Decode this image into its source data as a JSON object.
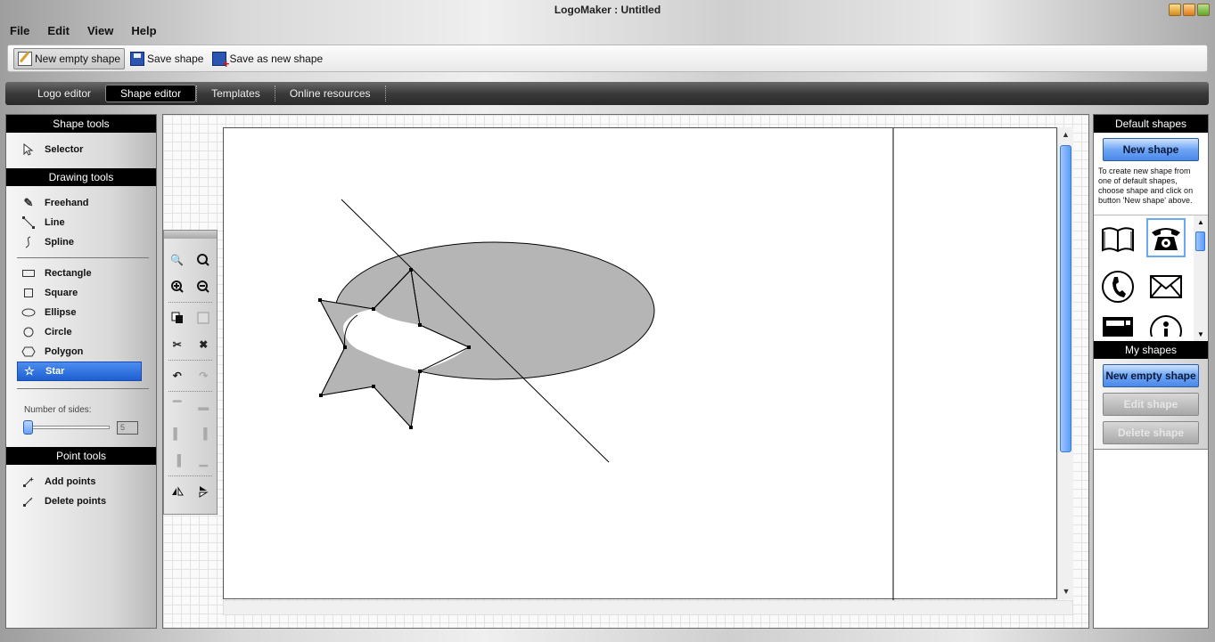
{
  "window": {
    "title": "LogoMaker : Untitled"
  },
  "menu": [
    "File",
    "Edit",
    "View",
    "Help"
  ],
  "toolbar": {
    "new_empty_shape": "New empty shape",
    "save_shape": "Save shape",
    "save_as_new_shape": "Save as new shape"
  },
  "tabs": [
    "Logo editor",
    "Shape editor",
    "Templates",
    "Online resources"
  ],
  "active_tab": "Shape editor",
  "left_panel": {
    "shape_tools_header": "Shape tools",
    "selector": "Selector",
    "drawing_tools_header": "Drawing tools",
    "freehand": "Freehand",
    "line": "Line",
    "spline": "Spline",
    "rectangle": "Rectangle",
    "square": "Square",
    "ellipse": "Ellipse",
    "circle": "Circle",
    "polygon": "Polygon",
    "star": "Star",
    "number_of_sides_label": "Number of sides:",
    "number_of_sides_value": "5",
    "point_tools_header": "Point tools",
    "add_points": "Add points",
    "delete_points": "Delete points"
  },
  "right_panel": {
    "default_shapes_header": "Default shapes",
    "new_shape": "New shape",
    "hint": "To create new shape from one of default shapes, choose shape and click on button 'New shape' above.",
    "shapes": [
      "book-icon",
      "telephone-icon",
      "handset-icon",
      "envelope-icon",
      "fax-icon",
      "info-icon"
    ],
    "my_shapes_header": "My shapes",
    "new_empty_shape": "New empty shape",
    "edit_shape": "Edit shape",
    "delete_shape": "Delete shape"
  },
  "colors": {
    "accent_blue": "#4a88e8",
    "shape_fill": "#b5b5b5",
    "header_black": "#000000"
  }
}
